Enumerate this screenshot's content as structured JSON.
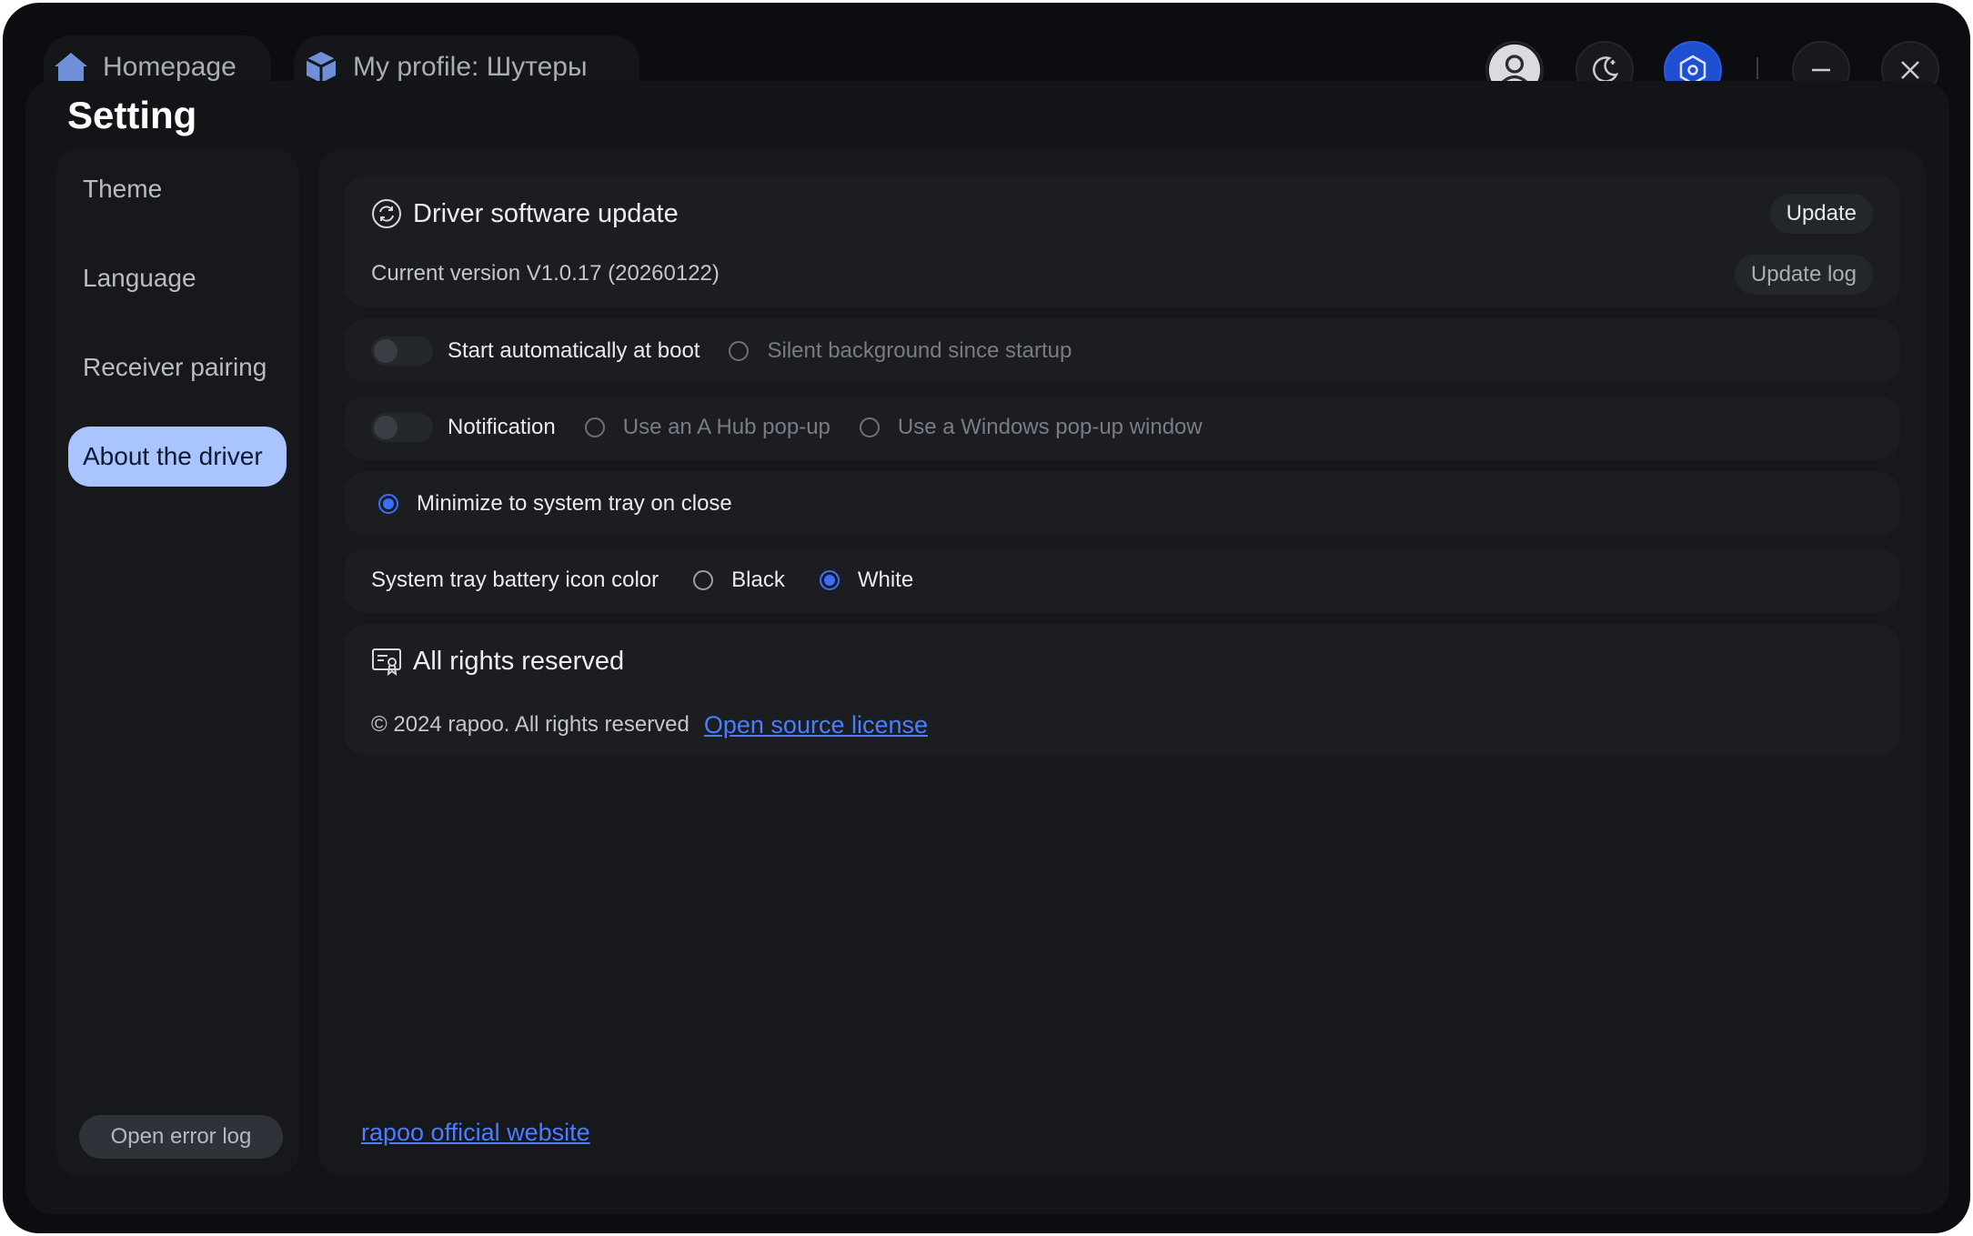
{
  "tabs": {
    "home": "Homepage",
    "profile": "My profile: Шутеры"
  },
  "page_title": "Setting",
  "sidebar": {
    "items": [
      "Theme",
      "Language",
      "Receiver pairing",
      "About the driver"
    ],
    "active_index": 3,
    "error_log_button": "Open error log"
  },
  "update": {
    "title": "Driver software update",
    "update_button": "Update",
    "current_version": "Current version V1.0.17 (20260122)",
    "update_log_button": "Update log"
  },
  "startup": {
    "toggle_label": "Start automatically at boot",
    "toggle_on": false,
    "silent_option": "Silent background since startup"
  },
  "notification": {
    "toggle_label": "Notification",
    "toggle_on": false,
    "option_hub": "Use an A Hub pop-up",
    "option_windows": "Use a Windows pop-up window"
  },
  "tray": {
    "minimize_label": "Minimize to system tray on close",
    "minimize_selected": true
  },
  "battery_color": {
    "label": "System tray battery icon color",
    "option_black": "Black",
    "option_white": "White",
    "selected": "White"
  },
  "rights": {
    "title": "All rights reserved",
    "copyright": "© 2024 rapoo. All rights reserved",
    "license_link": "Open source license"
  },
  "website_link": "rapoo official website",
  "colors": {
    "accent": "#3d6dff",
    "active_nav": "#a9c4ff",
    "link": "#4a7dff"
  }
}
